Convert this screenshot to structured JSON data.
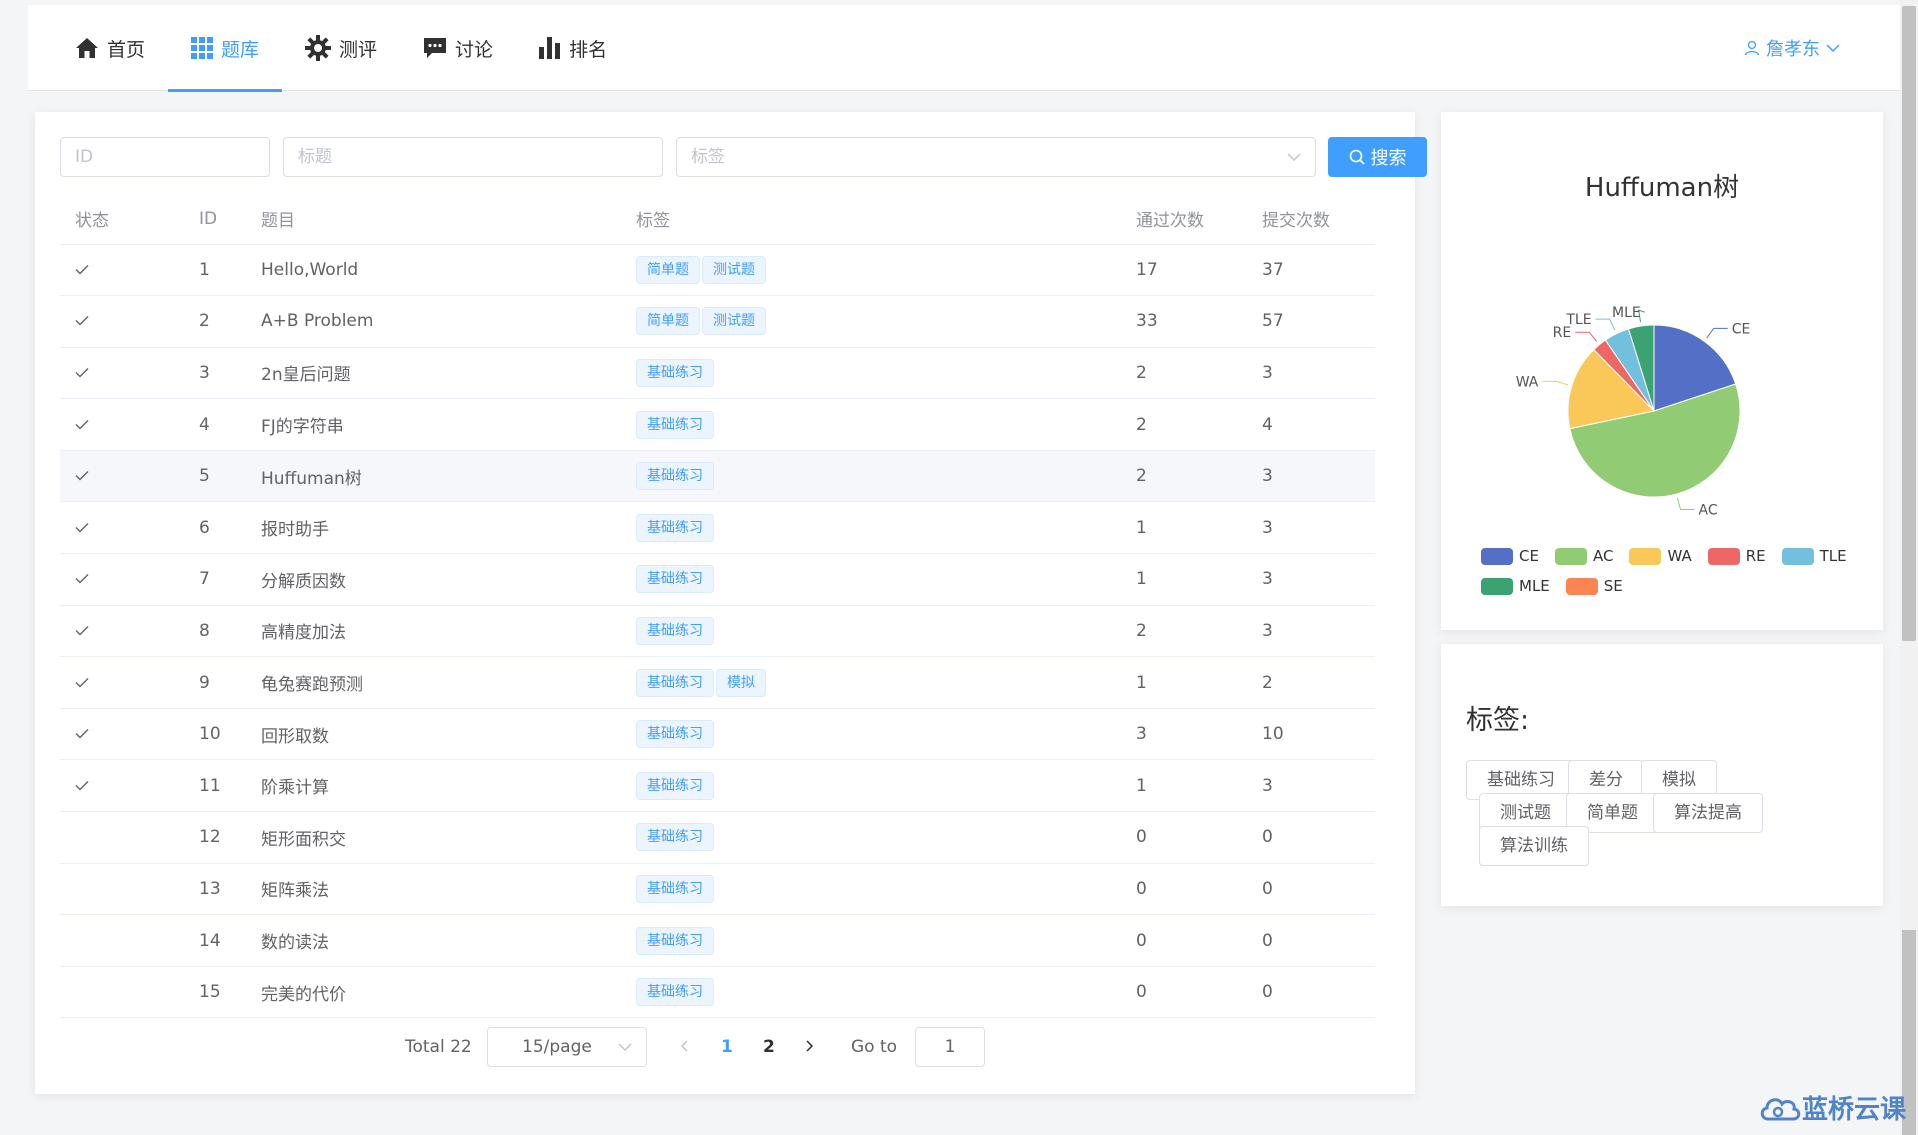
{
  "nav": {
    "items": [
      {
        "label": "首页",
        "icon": "home-icon"
      },
      {
        "label": "题库",
        "icon": "grid-icon",
        "active": true
      },
      {
        "label": "测评",
        "icon": "gear-icon"
      },
      {
        "label": "讨论",
        "icon": "chat-icon"
      },
      {
        "label": "排名",
        "icon": "bar-chart-icon"
      }
    ],
    "user": "詹孝东"
  },
  "filters": {
    "id_placeholder": "ID",
    "title_placeholder": "标题",
    "tag_placeholder": "标签",
    "search_label": "搜索"
  },
  "table": {
    "headers": [
      "状态",
      "ID",
      "题目",
      "标签",
      "通过次数",
      "提交次数"
    ],
    "rows": [
      {
        "solved": true,
        "id": "1",
        "title": "Hello,World",
        "tags": [
          "简单题",
          "测试题"
        ],
        "accepted": "17",
        "submitted": "37"
      },
      {
        "solved": true,
        "id": "2",
        "title": "A+B Problem",
        "tags": [
          "简单题",
          "测试题"
        ],
        "accepted": "33",
        "submitted": "57"
      },
      {
        "solved": true,
        "id": "3",
        "title": "2n皇后问题",
        "tags": [
          "基础练习"
        ],
        "accepted": "2",
        "submitted": "3"
      },
      {
        "solved": true,
        "id": "4",
        "title": "FJ的字符串",
        "tags": [
          "基础练习"
        ],
        "accepted": "2",
        "submitted": "4"
      },
      {
        "solved": true,
        "id": "5",
        "title": "Huffuman树",
        "tags": [
          "基础练习"
        ],
        "accepted": "2",
        "submitted": "3"
      },
      {
        "solved": true,
        "id": "6",
        "title": "报时助手",
        "tags": [
          "基础练习"
        ],
        "accepted": "1",
        "submitted": "3"
      },
      {
        "solved": true,
        "id": "7",
        "title": "分解质因数",
        "tags": [
          "基础练习"
        ],
        "accepted": "1",
        "submitted": "3"
      },
      {
        "solved": true,
        "id": "8",
        "title": "高精度加法",
        "tags": [
          "基础练习"
        ],
        "accepted": "2",
        "submitted": "3"
      },
      {
        "solved": true,
        "id": "9",
        "title": "龟兔赛跑预测",
        "tags": [
          "基础练习",
          "模拟"
        ],
        "accepted": "1",
        "submitted": "2"
      },
      {
        "solved": true,
        "id": "10",
        "title": "回形取数",
        "tags": [
          "基础练习"
        ],
        "accepted": "3",
        "submitted": "10"
      },
      {
        "solved": true,
        "id": "11",
        "title": "阶乘计算",
        "tags": [
          "基础练习"
        ],
        "accepted": "1",
        "submitted": "3"
      },
      {
        "solved": false,
        "id": "12",
        "title": "矩形面积交",
        "tags": [
          "基础练习"
        ],
        "accepted": "0",
        "submitted": "0"
      },
      {
        "solved": false,
        "id": "13",
        "title": "矩阵乘法",
        "tags": [
          "基础练习"
        ],
        "accepted": "0",
        "submitted": "0"
      },
      {
        "solved": false,
        "id": "14",
        "title": "数的读法",
        "tags": [
          "基础练习"
        ],
        "accepted": "0",
        "submitted": "0"
      },
      {
        "solved": false,
        "id": "15",
        "title": "完美的代价",
        "tags": [
          "基础练习"
        ],
        "accepted": "0",
        "submitted": "0"
      }
    ]
  },
  "pagination": {
    "total": "Total 22",
    "page_size": "15/page",
    "pages": [
      "1",
      "2"
    ],
    "current": "1",
    "goto_label": "Go to",
    "goto_value": "1"
  },
  "chart_data": {
    "type": "pie",
    "title": "Huffuman树",
    "slices": [
      {
        "name": "CE",
        "value": 5,
        "color": "#5470c6"
      },
      {
        "name": "AC",
        "value": 13,
        "color": "#91cc75"
      },
      {
        "name": "WA",
        "value": 4,
        "color": "#fac858"
      },
      {
        "name": "RE",
        "value": 0.7,
        "color": "#ee6666"
      },
      {
        "name": "TLE",
        "value": 1.2,
        "color": "#73c0de"
      },
      {
        "name": "MLE",
        "value": 1.2,
        "color": "#3ba272"
      },
      {
        "name": "SE",
        "value": 0,
        "color": "#fc8452"
      }
    ]
  },
  "tag_panel": {
    "title": "标签:",
    "tags": [
      "基础练习",
      "差分",
      "模拟",
      "测试题",
      "简单题",
      "算法提高",
      "算法训练"
    ]
  },
  "watermark": "蓝桥云课"
}
